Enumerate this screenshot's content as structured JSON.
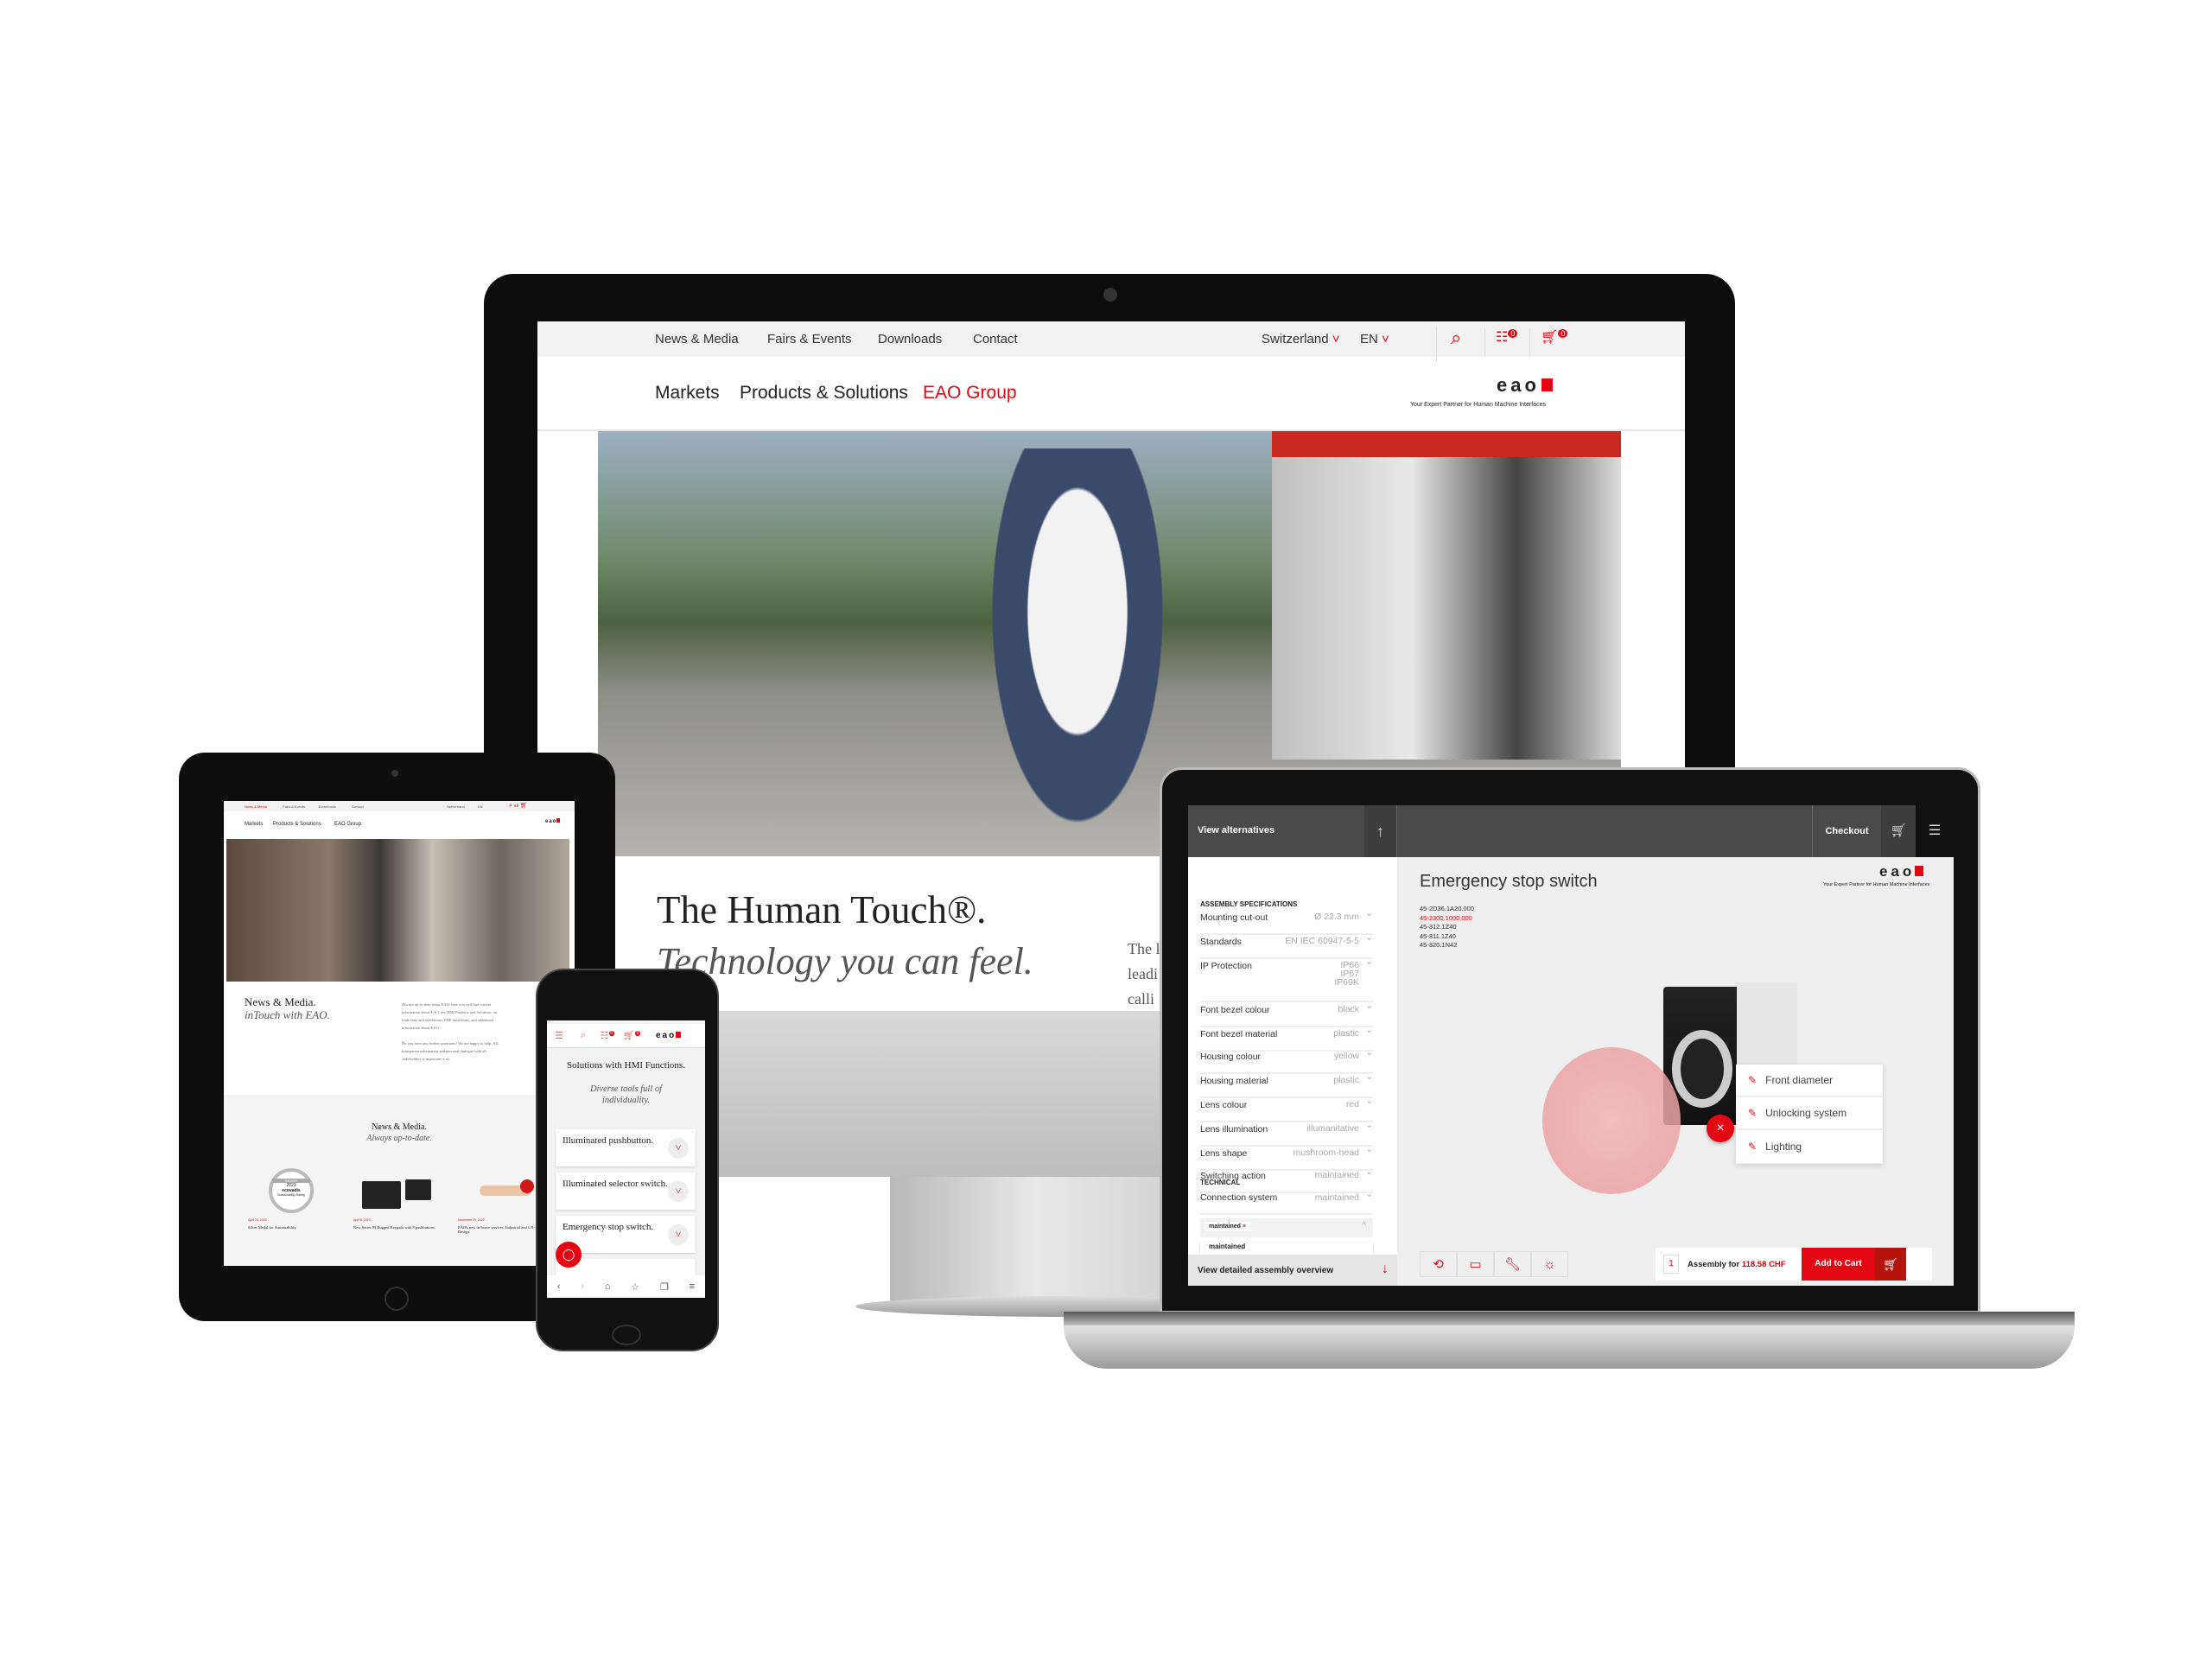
{
  "desktop": {
    "topnav": [
      "News & Media",
      "Fairs & Events",
      "Downloads",
      "Contact"
    ],
    "country": "Switzerland",
    "language": "EN",
    "cart_count": "0",
    "compare_count": "0",
    "mainnav": [
      "Markets",
      "Products & Solutions",
      "EAO Group"
    ],
    "logo": "eao",
    "tagline": "Your Expert Partner for Human Machine Interfaces",
    "headline": "The Human Touch®.",
    "subline": "Technology you can feel.",
    "side_text": [
      "The l",
      "leadi",
      "calli"
    ],
    "accent": "#e30613"
  },
  "laptop": {
    "view_alternatives": "View alternatives",
    "checkout": "Checkout",
    "spec_heading": "ASSEMBLY SPECIFICATIONS",
    "specs": [
      {
        "label": "Mounting cut-out",
        "value": "Ø 22.3 mm"
      },
      {
        "label": "Standards",
        "value": "EN IEC 60947-5-5"
      },
      {
        "label": "IP Protection",
        "value": "IP66\nIP67\nIP69K"
      },
      {
        "label": "Font bezel colour",
        "value": "black"
      },
      {
        "label": "Font bezel material",
        "value": "plastic"
      },
      {
        "label": "Housing colour",
        "value": "yellow"
      },
      {
        "label": "Housing material",
        "value": "plastic"
      },
      {
        "label": "Lens colour",
        "value": "red"
      },
      {
        "label": "Lens illumination",
        "value": "illumanitative"
      },
      {
        "label": "Lens shape",
        "value": "mushroom-head"
      },
      {
        "label": "Switching action",
        "value": "maintained"
      }
    ],
    "technical_heading": "TECHNICAL",
    "connection": {
      "label": "Connection system",
      "value": "maintained"
    },
    "chip": "maintained",
    "dropdown_option": "maintained",
    "overview": "View detailed assembly overview",
    "title": "Emergency stop switch",
    "parts": [
      "45-2D36.1A20.000",
      "45-2300.1000.000",
      "45-312.1Z40",
      "45-311.1Z40",
      "45-320.1N42"
    ],
    "menu": [
      "Front diameter",
      "Unlocking system",
      "Lighting"
    ],
    "quantity": "1",
    "assembly_label": "Assembly for",
    "price": "118.58 CHF",
    "add_to_cart": "Add to Cart",
    "tools": [
      "rotate-view-icon",
      "ruler-icon",
      "wrench-icon",
      "bulb-icon"
    ],
    "logo": "eao",
    "tagline": "Your Expert Partner for Human Machine Interfaces"
  },
  "tablet": {
    "topnav": [
      "News & Media",
      "Fairs & Events",
      "Downloads",
      "Contact"
    ],
    "country": "Switzerland",
    "language": "EN",
    "mainnav": [
      "Markets",
      "Products & Solutions",
      "EAO Group"
    ],
    "logo": "eao",
    "title": "News & Media.",
    "subtitle": "inTouch with EAO.",
    "para1": "Always up-to-date about EAO: here you will find current information about EAO, our HMI Products and Solutions, on trade fairs and exhibitions, PDF downloads, and additional information about EAO.",
    "para2": "Do you have any further questions? We are happy to help. All, transparent information and personal dialogue with all stakeholders is important to us.",
    "section_title": "News & Media.",
    "section_subtitle": "Always up-to-date.",
    "news": [
      {
        "date": "April 24, 2023",
        "title": "Silver Medal for Sustainability."
      },
      {
        "date": "April 5, 2023",
        "title": "New Series 09 Rugged Keypads with 8 pushbuttons."
      },
      {
        "date": "November 29, 2022",
        "title": "EAO's new in-house services: Industrial and UX-Design."
      }
    ],
    "badge": {
      "rank": "SILVER",
      "year": "2023",
      "brand": "ecovadis",
      "caption": "Sustainability Rating"
    }
  },
  "phone": {
    "logo": "eao",
    "cart_count": "0",
    "compare_count": "0",
    "title": "Solutions with HMI Functions.",
    "subtitle": "Diverse tools full of individuality.",
    "cards": [
      "Illuminated pushbutton.",
      "Illuminated selector switch.",
      "Emergency stop switch.",
      ""
    ]
  }
}
